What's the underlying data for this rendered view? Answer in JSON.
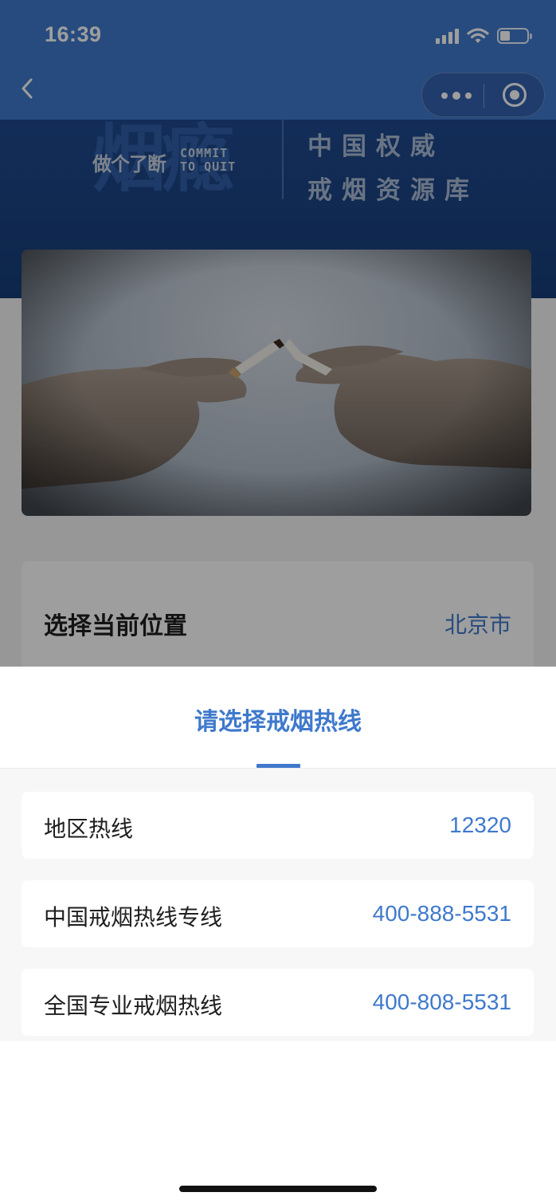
{
  "status_bar": {
    "time": "16:39",
    "icons": [
      "signal-icon",
      "wifi-icon",
      "battery-icon"
    ]
  },
  "nav_bar": {
    "back_icon": "chevron-left-icon",
    "capsule_icons": [
      "more-dots-icon",
      "close-target-icon"
    ]
  },
  "hero": {
    "logo_big_text": "烟瘾",
    "logo_cn": "做个了断",
    "logo_en_line1": "COMMIT",
    "logo_en_line2": "TO QUIT",
    "title_line1": "中国权威",
    "title_line2": "戒烟资源库"
  },
  "location": {
    "label": "选择当前位置",
    "value": "北京市"
  },
  "sheet": {
    "title": "请选择戒烟热线",
    "hotlines": [
      {
        "name": "地区热线",
        "number": "12320"
      },
      {
        "name": "中国戒烟热线专线",
        "number": "400-888-5531"
      },
      {
        "name": "全国专业戒烟热线",
        "number": "400-808-5531"
      }
    ]
  },
  "colors": {
    "accent": "#3f79cc",
    "hero_dark": "#1f4a8f",
    "text_primary": "#1f1f1f"
  }
}
